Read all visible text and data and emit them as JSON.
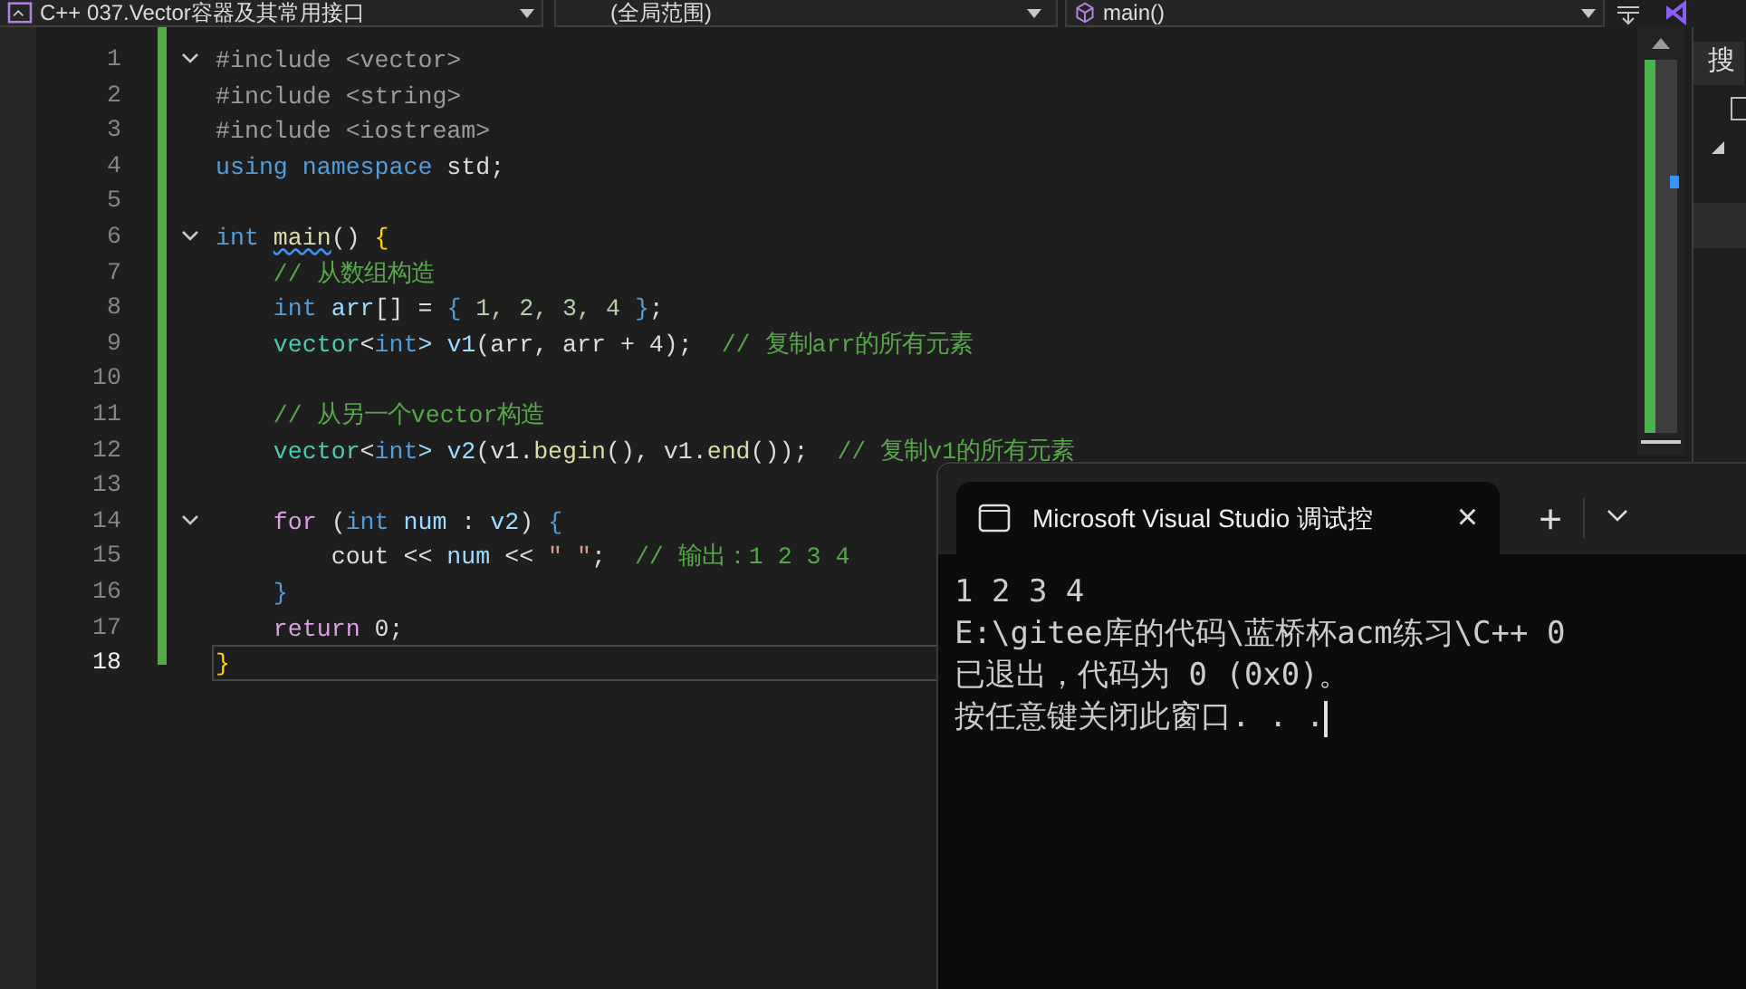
{
  "toolbar": {
    "project": "C++ 037.Vector容器及其常用接口",
    "scope": "(全局范围)",
    "member": "main()"
  },
  "editor": {
    "lines": [
      {
        "number": "1",
        "collapsible": true,
        "selected": false,
        "tokens": [
          {
            "t": "#include <vector>",
            "kind": "pre"
          }
        ]
      },
      {
        "number": "2",
        "collapsible": false,
        "selected": false,
        "tokens": [
          {
            "t": "#include <string>",
            "kind": "pre"
          }
        ]
      },
      {
        "number": "3",
        "collapsible": false,
        "selected": false,
        "tokens": [
          {
            "t": "#include <iostream>",
            "kind": "pre"
          }
        ]
      },
      {
        "number": "4",
        "collapsible": false,
        "selected": false,
        "tokens": [
          {
            "t": "using namespace",
            "kind": "kw"
          },
          {
            "t": " std;",
            "kind": "plain"
          }
        ]
      },
      {
        "number": "5",
        "collapsible": false,
        "selected": false
      },
      {
        "number": "6",
        "collapsible": true,
        "selected": false,
        "tokens": [
          {
            "t": "int ",
            "kind": "kw"
          },
          {
            "t": "main",
            "kind": "func",
            "squiggle": true
          },
          {
            "t": "() ",
            "kind": "plain"
          },
          {
            "t": "{",
            "kind": "brace"
          }
        ]
      },
      {
        "number": "7",
        "collapsible": false,
        "selected": false,
        "tokens": [
          {
            "t": "    // 从数组构造",
            "kind": "comment"
          }
        ]
      },
      {
        "number": "8",
        "collapsible": false,
        "selected": false,
        "tokens": [
          {
            "t": "    int",
            "kind": "kw"
          },
          {
            "t": " arr",
            "kind": "var"
          },
          {
            "t": "[] = ",
            "kind": "plain"
          },
          {
            "t": "{",
            "kind": "kw"
          },
          {
            "t": " 1, 2, 3, 4 ",
            "kind": "num"
          },
          {
            "t": "}",
            "kind": "kw"
          },
          {
            "t": ";",
            "kind": "plain"
          }
        ]
      },
      {
        "number": "9",
        "collapsible": false,
        "selected": false,
        "tokens": [
          {
            "t": "    vector",
            "kind": "type"
          },
          {
            "t": "<",
            "kind": "plain"
          },
          {
            "t": "int",
            "kind": "kw"
          },
          {
            "t": "> v1",
            "kind": "var"
          },
          {
            "t": "(arr, arr + 4);  ",
            "kind": "plain"
          },
          {
            "t": "// 复制arr的所有元素",
            "kind": "comment"
          }
        ]
      },
      {
        "number": "10",
        "collapsible": false,
        "selected": false
      },
      {
        "number": "11",
        "collapsible": false,
        "selected": false,
        "tokens": [
          {
            "t": "    // 从另一个vector构造",
            "kind": "comment"
          }
        ]
      },
      {
        "number": "12",
        "collapsible": false,
        "selected": false,
        "tokens": [
          {
            "t": "    vector",
            "kind": "type"
          },
          {
            "t": "<",
            "kind": "plain"
          },
          {
            "t": "int",
            "kind": "kw"
          },
          {
            "t": "> v2",
            "kind": "var"
          },
          {
            "t": "(v1.",
            "kind": "plain"
          },
          {
            "t": "begin",
            "kind": "func"
          },
          {
            "t": "(), v1.",
            "kind": "plain"
          },
          {
            "t": "end",
            "kind": "func"
          },
          {
            "t": "());  ",
            "kind": "plain"
          },
          {
            "t": "// 复制v1的所有元素",
            "kind": "comment"
          }
        ]
      },
      {
        "number": "13",
        "collapsible": false,
        "selected": false
      },
      {
        "number": "14",
        "collapsible": true,
        "selected": false,
        "tokens": [
          {
            "t": "    for",
            "kind": "ctrl"
          },
          {
            "t": " (",
            "kind": "plain"
          },
          {
            "t": "int",
            "kind": "kw"
          },
          {
            "t": " num",
            "kind": "var"
          },
          {
            "t": " : ",
            "kind": "plain"
          },
          {
            "t": "v2",
            "kind": "var"
          },
          {
            "t": ") ",
            "kind": "plain"
          },
          {
            "t": "{",
            "kind": "kw"
          }
        ]
      },
      {
        "number": "15",
        "collapsible": false,
        "selected": false,
        "tokens": [
          {
            "t": "        cout << ",
            "kind": "plain"
          },
          {
            "t": "num",
            "kind": "var"
          },
          {
            "t": " << ",
            "kind": "plain"
          },
          {
            "t": "\" \"",
            "kind": "string"
          },
          {
            "t": ";  ",
            "kind": "plain"
          },
          {
            "t": "// 输出：1 2 3 4",
            "kind": "comment"
          }
        ]
      },
      {
        "number": "16",
        "collapsible": false,
        "selected": false,
        "tokens": [
          {
            "t": "    }",
            "kind": "kw"
          }
        ]
      },
      {
        "number": "17",
        "collapsible": false,
        "selected": false,
        "tokens": [
          {
            "t": "    return",
            "kind": "ctrl"
          },
          {
            "t": " 0;",
            "kind": "plain"
          }
        ]
      },
      {
        "number": "18",
        "collapsible": false,
        "selected": true,
        "tokens": [
          {
            "t": "}",
            "kind": "brace"
          }
        ]
      }
    ]
  },
  "side_panel": {
    "search_label": "搜"
  },
  "terminal": {
    "tab_title": "Microsoft Visual Studio 调试控",
    "close": "×",
    "new_tab": "+",
    "lines": [
      "1 2 3 4",
      "E:\\gitee库的代码\\蓝桥杯acm练习\\C++ 0",
      "已退出，代码为 0 (0x0)。",
      "按任意键关闭此窗口. . ."
    ],
    "cursor": true
  }
}
